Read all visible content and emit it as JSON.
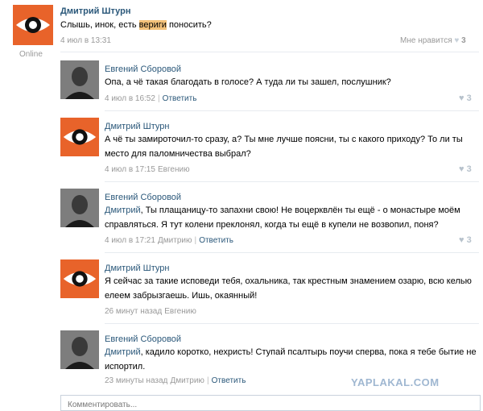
{
  "post": {
    "author": "Дмитрий Штурн",
    "online": "Online",
    "text_before": "Слышь, инок, есть ",
    "text_highlight": "вериги",
    "text_after": " поносить?",
    "time": "4 июл в 13:31",
    "like_label": "Мне нравится",
    "like_count": "3"
  },
  "comments": [
    {
      "author": "Евгений Сборовой",
      "avatar": "man",
      "lines": [
        "Опа, а чё такая благодать в голосе? А туда ли ты зашел, послушник?"
      ],
      "time": "4 июл в 16:52",
      "action": "Ответить",
      "likes": "3"
    },
    {
      "author": "Дмитрий Штурн",
      "avatar": "eye",
      "lines": [
        "А чё ты замироточил-то сразу, а? Ты мне лучше поясни, ты с какого приходу? То ли ты",
        "место для паломничества выбрал?"
      ],
      "time": "4 июл в 17:15",
      "to": "Евгению",
      "likes": "3"
    },
    {
      "author": "Евгений Сборовой",
      "avatar": "man",
      "appeal": "Дмитрий",
      "lines": [
        ", Ты плащаницу-то запахни свою! Не воцерквлён ты ещё - о монастыре моём",
        "справляться. Я тут колени преклонял, когда ты ещё в купели не возвопил, поня?"
      ],
      "time": "4 июл в 17:21",
      "to": "Дмитрию",
      "action": "Ответить",
      "likes": "3"
    },
    {
      "author": "Дмитрий Штурн",
      "avatar": "eye",
      "lines": [
        "Я сейчас за такие исповеди тебя, охальника, так крестным знамением озарю, всю келью",
        "елеем забрызгаешь. Ишь, окаянный!"
      ],
      "time": "26 минут назад",
      "to": "Евгению"
    },
    {
      "author": "Евгений Сборовой",
      "avatar": "man",
      "appeal": "Дмитрий",
      "lines": [
        ", кадило коротко, нехристь! Ступай псалтырь поучи сперва, пока я тебе бытие не",
        "испортил."
      ],
      "time": "23 минуты назад",
      "to": "Дмитрию",
      "action": "Ответить"
    }
  ],
  "input": {
    "placeholder": "Комментировать..."
  },
  "watermark": "YAPLAKAL.COM",
  "colors": {
    "link": "#2b587a",
    "avatar_orange": "#e8632a",
    "highlight": "#f3c27a",
    "muted": "#999999"
  }
}
